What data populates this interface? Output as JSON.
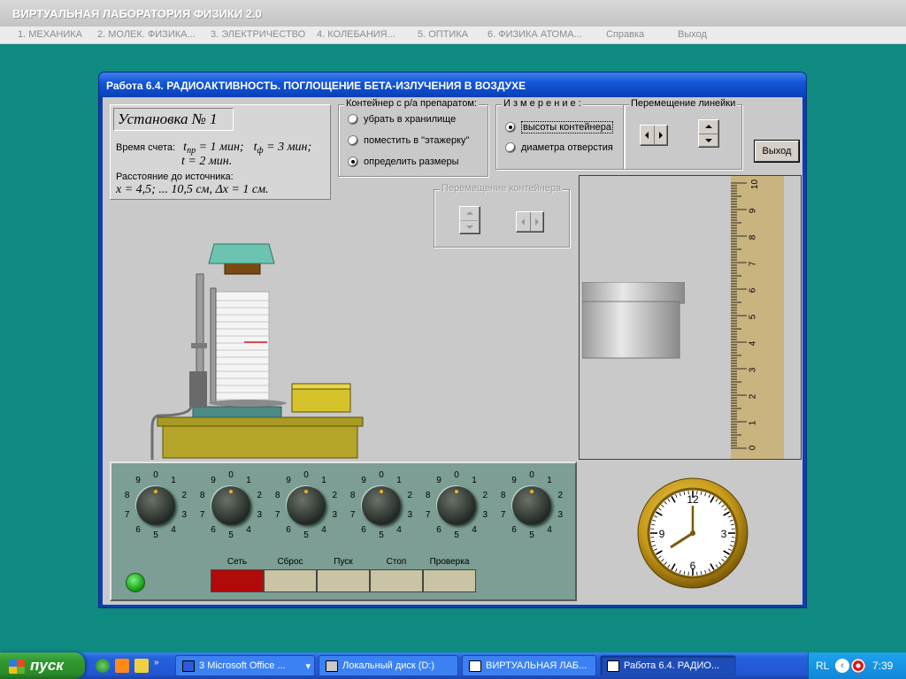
{
  "app": {
    "title": "ВИРТУАЛЬНАЯ ЛАБОРАТОРИЯ ФИЗИКИ 2.0",
    "menu": [
      "1. МЕХАНИКА",
      "2. МОЛЕК. ФИЗИКА...",
      "3. ЭЛЕКТРИЧЕСТВО",
      "4. КОЛЕБАНИЯ...",
      "5. ОПТИКА",
      "6. ФИЗИКА  АТОМА...",
      "Справка",
      "Выход"
    ]
  },
  "lab": {
    "title": "Работа 6.4. РАДИОАКТИВНОСТЬ. ПОГЛОЩЕНИЕ БЕТА-ИЗЛУЧЕНИЯ В ВОЗДУХЕ",
    "setup": {
      "title": "Установка № 1",
      "count_time_label": "Время счета:",
      "t_pr": "t",
      "t_pr_sub": "пр",
      "t_pr_value": " = 1 мин;",
      "t_f": "t",
      "t_f_sub": "ф",
      "t_f_value": " = 3 мин;",
      "t_line": "t = 2 мин.",
      "distance_label": "Расстояние до источника:",
      "distance_values": "x = 4,5; ... 10,5 см,   Δx = 1 см."
    },
    "container_group": {
      "label": "Контейнер с р/а препаратом:",
      "options": [
        "убрать в хранилище",
        "поместить в \"этажерку\"",
        "определить размеры"
      ],
      "selected": 2
    },
    "measure_group": {
      "label": "И з м е р е н и е :",
      "options": [
        "высоты контейнера",
        "диаметра отверстия"
      ],
      "selected": 0
    },
    "ruler_move_group": {
      "label": "Перемещение линейки"
    },
    "container_move_group": {
      "label": "Перемещение контейнера"
    },
    "exit_button": "Выход",
    "ruler_numbers": [
      "10",
      "9",
      "8",
      "7",
      "6",
      "5",
      "4",
      "3",
      "2",
      "1",
      "0"
    ],
    "knob_digits": [
      "0",
      "1",
      "2",
      "3",
      "4",
      "5",
      "6",
      "7",
      "8",
      "9"
    ],
    "panel_buttons": [
      "Сеть",
      "Сброс",
      "Пуск",
      "Стоп",
      "Проверка"
    ],
    "clock_numbers": [
      "12",
      "3",
      "6",
      "9"
    ],
    "colors": {
      "power_on": "#b10a0a",
      "led": "#0c9a0c",
      "panel": "#7c9e94"
    }
  },
  "taskbar": {
    "start": "пуск",
    "tasks": [
      "Microsoft Office ...",
      "Локальный диск (D:)",
      "ВИРТУАЛЬНАЯ ЛАБ...",
      "Работа 6.4. РАДИО..."
    ],
    "word_count": "3",
    "active_task": 3,
    "lang": "RL",
    "time": "7:39"
  }
}
